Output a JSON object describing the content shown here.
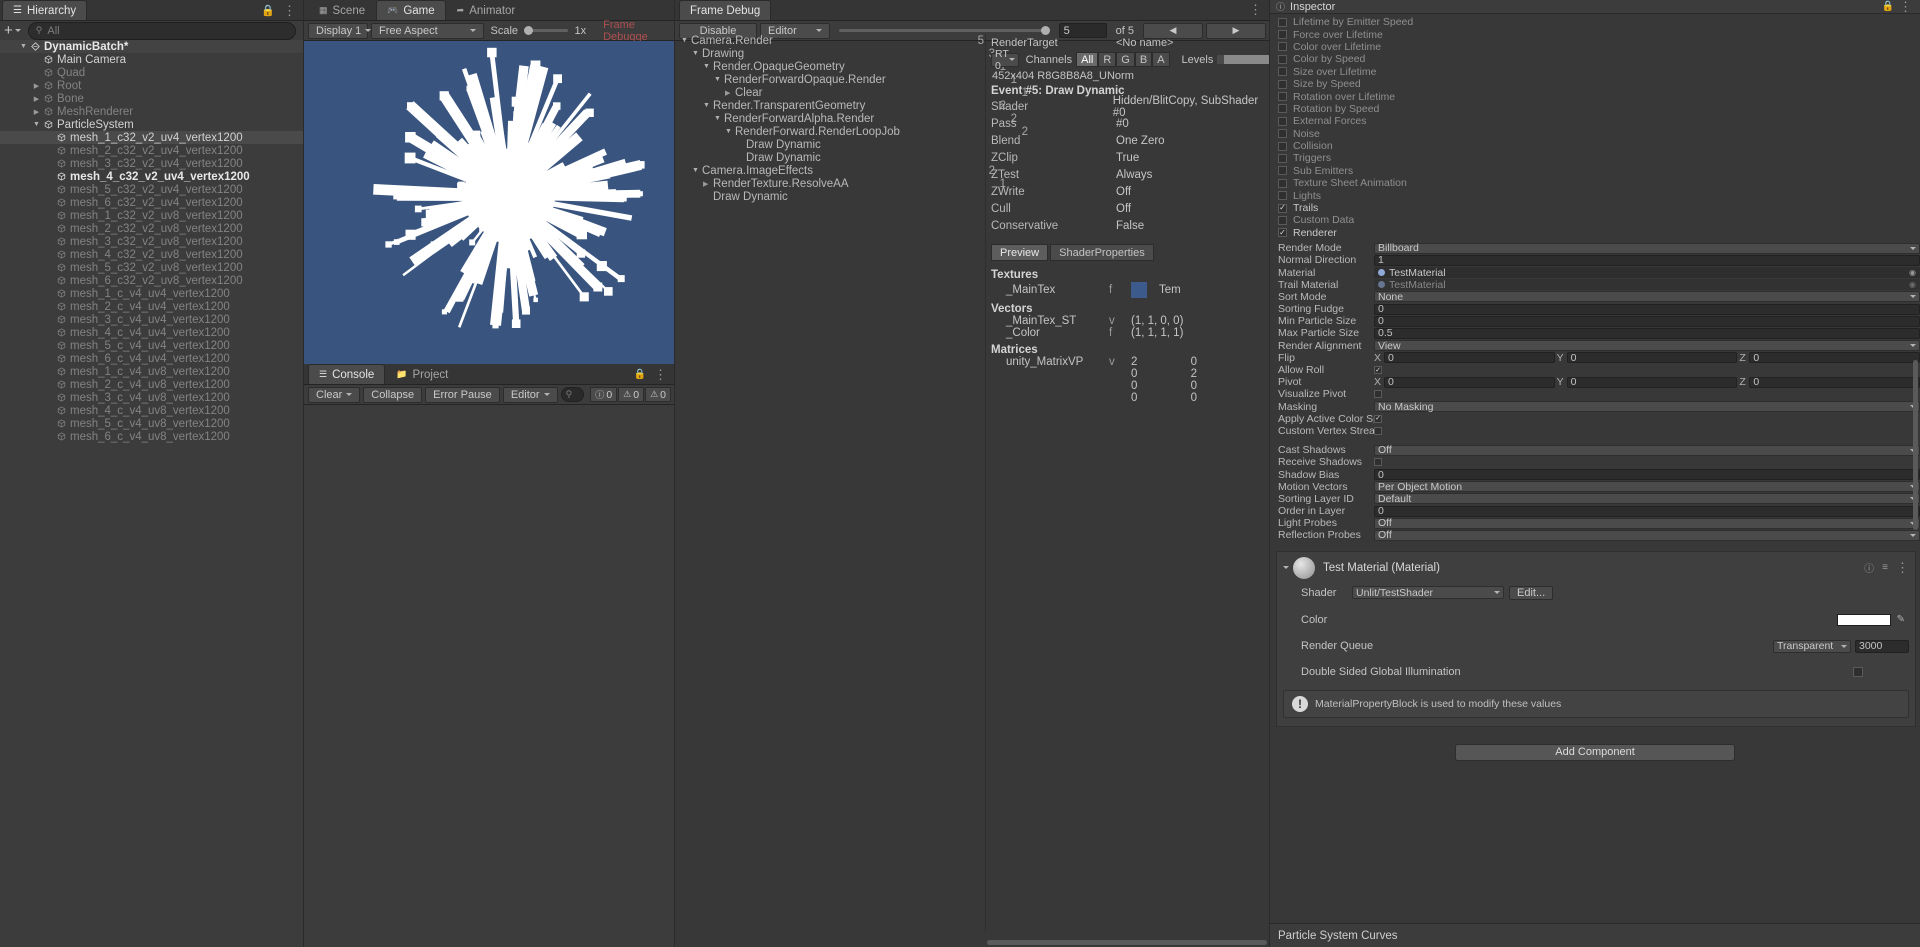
{
  "hierarchy": {
    "tab": "Hierarchy",
    "tab_icon": "hierarchy-icon",
    "lock_icon": "lock-icon",
    "menu_icon": "kebab-menu-icon",
    "add_label": "+",
    "search_placeholder": "All",
    "search_value": "",
    "items": [
      {
        "label": "DynamicBatch*",
        "depth": 0,
        "arrow": "down",
        "icon": "scene-icon",
        "state": "root",
        "bold": true
      },
      {
        "label": "Main Camera",
        "depth": 1,
        "arrow": "none",
        "icon": "gameobject-icon",
        "state": "normal"
      },
      {
        "label": "Quad",
        "depth": 1,
        "arrow": "none",
        "icon": "gameobject-icon",
        "state": "dim"
      },
      {
        "label": "Root",
        "depth": 1,
        "arrow": "right",
        "icon": "gameobject-icon",
        "state": "dim"
      },
      {
        "label": "Bone",
        "depth": 1,
        "arrow": "right",
        "icon": "gameobject-icon",
        "state": "dim"
      },
      {
        "label": "MeshRenderer",
        "depth": 1,
        "arrow": "right",
        "icon": "gameobject-icon",
        "state": "dim"
      },
      {
        "label": "ParticleSystem",
        "depth": 1,
        "arrow": "down",
        "icon": "gameobject-icon",
        "state": "normal"
      },
      {
        "label": "mesh_1_c32_v2_uv4_vertex1200",
        "depth": 2,
        "arrow": "none",
        "icon": "gameobject-icon",
        "state": "selected"
      },
      {
        "label": "mesh_2_c32_v2_uv4_vertex1200",
        "depth": 2,
        "arrow": "none",
        "icon": "gameobject-icon",
        "state": "dim"
      },
      {
        "label": "mesh_3_c32_v2_uv4_vertex1200",
        "depth": 2,
        "arrow": "none",
        "icon": "gameobject-icon",
        "state": "dim"
      },
      {
        "label": "mesh_4_c32_v2_uv4_vertex1200",
        "depth": 2,
        "arrow": "none",
        "icon": "gameobject-icon",
        "state": "bold"
      },
      {
        "label": "mesh_5_c32_v2_uv4_vertex1200",
        "depth": 2,
        "arrow": "none",
        "icon": "gameobject-icon",
        "state": "dim"
      },
      {
        "label": "mesh_6_c32_v2_uv4_vertex1200",
        "depth": 2,
        "arrow": "none",
        "icon": "gameobject-icon",
        "state": "dim"
      },
      {
        "label": "mesh_1_c32_v2_uv8_vertex1200",
        "depth": 2,
        "arrow": "none",
        "icon": "gameobject-icon",
        "state": "dim"
      },
      {
        "label": "mesh_2_c32_v2_uv8_vertex1200",
        "depth": 2,
        "arrow": "none",
        "icon": "gameobject-icon",
        "state": "dim"
      },
      {
        "label": "mesh_3_c32_v2_uv8_vertex1200",
        "depth": 2,
        "arrow": "none",
        "icon": "gameobject-icon",
        "state": "dim"
      },
      {
        "label": "mesh_4_c32_v2_uv8_vertex1200",
        "depth": 2,
        "arrow": "none",
        "icon": "gameobject-icon",
        "state": "dim"
      },
      {
        "label": "mesh_5_c32_v2_uv8_vertex1200",
        "depth": 2,
        "arrow": "none",
        "icon": "gameobject-icon",
        "state": "dim"
      },
      {
        "label": "mesh_6_c32_v2_uv8_vertex1200",
        "depth": 2,
        "arrow": "none",
        "icon": "gameobject-icon",
        "state": "dim"
      },
      {
        "label": "mesh_1_c_v4_uv4_vertex1200",
        "depth": 2,
        "arrow": "none",
        "icon": "gameobject-icon",
        "state": "dim"
      },
      {
        "label": "mesh_2_c_v4_uv4_vertex1200",
        "depth": 2,
        "arrow": "none",
        "icon": "gameobject-icon",
        "state": "dim"
      },
      {
        "label": "mesh_3_c_v4_uv4_vertex1200",
        "depth": 2,
        "arrow": "none",
        "icon": "gameobject-icon",
        "state": "dim"
      },
      {
        "label": "mesh_4_c_v4_uv4_vertex1200",
        "depth": 2,
        "arrow": "none",
        "icon": "gameobject-icon",
        "state": "dim"
      },
      {
        "label": "mesh_5_c_v4_uv4_vertex1200",
        "depth": 2,
        "arrow": "none",
        "icon": "gameobject-icon",
        "state": "dim"
      },
      {
        "label": "mesh_6_c_v4_uv4_vertex1200",
        "depth": 2,
        "arrow": "none",
        "icon": "gameobject-icon",
        "state": "dim"
      },
      {
        "label": "mesh_1_c_v4_uv8_vertex1200",
        "depth": 2,
        "arrow": "none",
        "icon": "gameobject-icon",
        "state": "dim"
      },
      {
        "label": "mesh_2_c_v4_uv8_vertex1200",
        "depth": 2,
        "arrow": "none",
        "icon": "gameobject-icon",
        "state": "dim"
      },
      {
        "label": "mesh_3_c_v4_uv8_vertex1200",
        "depth": 2,
        "arrow": "none",
        "icon": "gameobject-icon",
        "state": "dim"
      },
      {
        "label": "mesh_4_c_v4_uv8_vertex1200",
        "depth": 2,
        "arrow": "none",
        "icon": "gameobject-icon",
        "state": "dim"
      },
      {
        "label": "mesh_5_c_v4_uv8_vertex1200",
        "depth": 2,
        "arrow": "none",
        "icon": "gameobject-icon",
        "state": "dim"
      },
      {
        "label": "mesh_6_c_v4_uv8_vertex1200",
        "depth": 2,
        "arrow": "none",
        "icon": "gameobject-icon",
        "state": "dim"
      }
    ]
  },
  "gameview": {
    "tabs": [
      {
        "label": "Scene",
        "icon": "scene-grid-icon",
        "active": false
      },
      {
        "label": "Game",
        "icon": "gamepad-icon",
        "active": true
      },
      {
        "label": "Animator",
        "icon": "animator-icon",
        "active": false
      }
    ],
    "display": "Display 1",
    "aspect": "Free Aspect",
    "scale_label": "Scale",
    "scale_value": "1x",
    "frame_debugger_label": "Frame Debugge",
    "frame_debugger_color": "#b05050",
    "background_color": "#39557f"
  },
  "console": {
    "tabs": [
      {
        "label": "Console",
        "icon": "console-icon",
        "active": true
      },
      {
        "label": "Project",
        "icon": "project-icon",
        "active": false
      }
    ],
    "lock_icon": "lock-icon",
    "menu_icon": "kebab-menu-icon",
    "clear_label": "Clear",
    "collapse_label": "Collapse",
    "error_pause_label": "Error Pause",
    "editor_label": "Editor",
    "search_placeholder": "",
    "counts": [
      {
        "icon": "log-icon",
        "value": "0"
      },
      {
        "icon": "warning-icon",
        "value": "0"
      },
      {
        "icon": "error-icon",
        "value": "0"
      }
    ]
  },
  "framedebug": {
    "tab": "Frame Debug",
    "disable_label": "Disable",
    "editor_label": "Editor",
    "event_index": "5",
    "event_total": "of 5",
    "prev_icon": "prev-arrow-icon",
    "next_icon": "next-arrow-icon",
    "menu_icon": "kebab-menu-icon",
    "tree": [
      {
        "label": "Camera.Render",
        "depth": 0,
        "arrow": "down",
        "count": "5"
      },
      {
        "label": "Drawing",
        "depth": 1,
        "arrow": "down",
        "count": "3"
      },
      {
        "label": "Render.OpaqueGeometry",
        "depth": 2,
        "arrow": "down",
        "count": "1"
      },
      {
        "label": "RenderForwardOpaque.Render",
        "depth": 3,
        "arrow": "down",
        "count": "1"
      },
      {
        "label": "Clear",
        "depth": 4,
        "arrow": "right",
        "count": "1"
      },
      {
        "label": "Render.TransparentGeometry",
        "depth": 2,
        "arrow": "down",
        "count": "2"
      },
      {
        "label": "RenderForwardAlpha.Render",
        "depth": 3,
        "arrow": "down",
        "count": "2"
      },
      {
        "label": "RenderForward.RenderLoopJob",
        "depth": 4,
        "arrow": "down",
        "count": "2"
      },
      {
        "label": "Draw Dynamic",
        "depth": 5,
        "arrow": "none",
        "count": ""
      },
      {
        "label": "Draw Dynamic",
        "depth": 5,
        "arrow": "none",
        "count": ""
      },
      {
        "label": "Camera.ImageEffects",
        "depth": 1,
        "arrow": "down",
        "count": "2"
      },
      {
        "label": "RenderTexture.ResolveAA",
        "depth": 2,
        "arrow": "right",
        "count": "1"
      },
      {
        "label": "Draw Dynamic",
        "depth": 2,
        "arrow": "none",
        "count": ""
      }
    ],
    "detail": {
      "render_target_label": "RenderTarget",
      "render_target_name": "<No name>",
      "rt_select": "RT 0",
      "channels_label": "Channels",
      "channels": [
        {
          "label": "All",
          "active": true
        },
        {
          "label": "R",
          "active": false
        },
        {
          "label": "G",
          "active": false
        },
        {
          "label": "B",
          "active": false
        },
        {
          "label": "A",
          "active": false
        }
      ],
      "levels_label": "Levels",
      "format": "452x404 R8G8B8A8_UNorm",
      "event_title": "Event #5: Draw Dynamic",
      "props": [
        {
          "key": "Shader",
          "value": "Hidden/BlitCopy, SubShader #0"
        },
        {
          "key": "Pass",
          "value": "#0"
        },
        {
          "key": "Blend",
          "value": "One Zero"
        },
        {
          "key": "ZClip",
          "value": "True"
        },
        {
          "key": "ZTest",
          "value": "Always"
        },
        {
          "key": "ZWrite",
          "value": "Off"
        },
        {
          "key": "Cull",
          "value": "Off"
        },
        {
          "key": "Conservative",
          "value": "False"
        }
      ],
      "preview_tabs": [
        {
          "label": "Preview",
          "active": true
        },
        {
          "label": "ShaderProperties",
          "active": false
        }
      ],
      "textures_title": "Textures",
      "textures": [
        {
          "name": "_MainTex",
          "flag": "f",
          "thumb": "texture-thumb",
          "value": "Tem"
        }
      ],
      "vectors_title": "Vectors",
      "vectors": [
        {
          "name": "_MainTex_ST",
          "flag": "v",
          "value": "(1, 1, 0, 0)"
        },
        {
          "name": "_Color",
          "flag": "f",
          "value": "(1, 1, 1, 1)"
        }
      ],
      "matrices_title": "Matrices",
      "matrices": [
        {
          "name": "unity_MatrixVP",
          "flag": "v",
          "rows": [
            [
              "2",
              "0"
            ],
            [
              "0",
              "2"
            ],
            [
              "0",
              "0"
            ],
            [
              "0",
              "0"
            ]
          ]
        }
      ]
    }
  },
  "inspector": {
    "tab": "Inspector",
    "tab_icon": "inspector-icon",
    "lock_icon": "lock-icon",
    "menu_icon": "kebab-menu-icon",
    "modules": [
      {
        "label": "Lifetime by Emitter Speed",
        "checked": false
      },
      {
        "label": "Force over Lifetime",
        "checked": false
      },
      {
        "label": "Color over Lifetime",
        "checked": false
      },
      {
        "label": "Color by Speed",
        "checked": false
      },
      {
        "label": "Size over Lifetime",
        "checked": false
      },
      {
        "label": "Size by Speed",
        "checked": false
      },
      {
        "label": "Rotation over Lifetime",
        "checked": false
      },
      {
        "label": "Rotation by Speed",
        "checked": false
      },
      {
        "label": "External Forces",
        "checked": false
      },
      {
        "label": "Noise",
        "checked": false
      },
      {
        "label": "Collision",
        "checked": false
      },
      {
        "label": "Triggers",
        "checked": false
      },
      {
        "label": "Sub Emitters",
        "checked": false
      },
      {
        "label": "Texture Sheet Animation",
        "checked": false
      },
      {
        "label": "Lights",
        "checked": false
      },
      {
        "label": "Trails",
        "checked": true
      },
      {
        "label": "Custom Data",
        "checked": false
      },
      {
        "label": "Renderer",
        "checked": true
      }
    ],
    "renderer_props": [
      {
        "label": "Render Mode",
        "type": "dropdown",
        "value": "Billboard"
      },
      {
        "label": "Normal Direction",
        "type": "text",
        "value": "1"
      },
      {
        "label": "Material",
        "type": "object",
        "value": "TestMaterial"
      },
      {
        "label": "Trail Material",
        "type": "object",
        "value": "TestMaterial",
        "disabled": true
      },
      {
        "label": "Sort Mode",
        "type": "dropdown",
        "value": "None"
      },
      {
        "label": "Sorting Fudge",
        "type": "text",
        "value": "0"
      },
      {
        "label": "Min Particle Size",
        "type": "text",
        "value": "0"
      },
      {
        "label": "Max Particle Size",
        "type": "text",
        "value": "0.5"
      },
      {
        "label": "Render Alignment",
        "type": "dropdown",
        "value": "View"
      },
      {
        "label": "Flip",
        "type": "xyz",
        "x": "0",
        "y": "0",
        "z": "0"
      },
      {
        "label": "Allow Roll",
        "type": "checkbox",
        "checked": true
      },
      {
        "label": "Pivot",
        "type": "xyz",
        "x": "0",
        "y": "0",
        "z": "0"
      },
      {
        "label": "Visualize Pivot",
        "type": "checkbox",
        "checked": false
      },
      {
        "label": "Masking",
        "type": "dropdown",
        "value": "No Masking"
      },
      {
        "label": "Apply Active Color Space",
        "type": "checkbox",
        "checked": true
      },
      {
        "label": "Custom Vertex Streams",
        "type": "checkbox",
        "checked": false
      }
    ],
    "shadow_props": [
      {
        "label": "Cast Shadows",
        "type": "dropdown",
        "value": "Off"
      },
      {
        "label": "Receive Shadows",
        "type": "checkbox",
        "checked": false
      },
      {
        "label": "Shadow Bias",
        "type": "text",
        "value": "0"
      },
      {
        "label": "Motion Vectors",
        "type": "dropdown",
        "value": "Per Object Motion"
      },
      {
        "label": "Sorting Layer ID",
        "type": "dropdown",
        "value": "Default"
      },
      {
        "label": "Order in Layer",
        "type": "text",
        "value": "0"
      },
      {
        "label": "Light Probes",
        "type": "dropdown",
        "value": "Off"
      },
      {
        "label": "Reflection Probes",
        "type": "dropdown",
        "value": "Off"
      }
    ],
    "material": {
      "title": "Test Material (Material)",
      "help_icon": "help-icon",
      "preset_icon": "preset-icon",
      "menu_icon": "kebab-menu-icon",
      "shader_label": "Shader",
      "shader_value": "Unlit/TestShader",
      "edit_label": "Edit...",
      "color_label": "Color",
      "color_value": "#ffffff",
      "eyedropper_icon": "eyedropper-icon",
      "render_queue_label": "Render Queue",
      "render_queue_mode": "Transparent",
      "render_queue_value": "3000",
      "dsgi_label": "Double Sided Global Illumination",
      "dsgi_checked": false,
      "warning_icon": "info-icon",
      "warning_text": "MaterialPropertyBlock is used to modify these values"
    },
    "add_component_label": "Add Component",
    "curves_title": "Particle System Curves"
  }
}
